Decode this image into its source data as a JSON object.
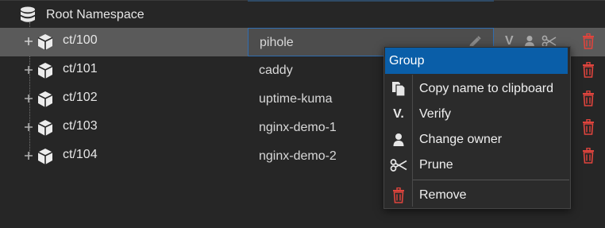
{
  "tree": {
    "root_label": "Root Namespace",
    "rows": [
      {
        "id": "ct/100",
        "name": "pihole",
        "selected": true
      },
      {
        "id": "ct/101",
        "name": "caddy"
      },
      {
        "id": "ct/102",
        "name": "uptime-kuma"
      },
      {
        "id": "ct/103",
        "name": "nginx-demo-1"
      },
      {
        "id": "ct/104",
        "name": "nginx-demo-2"
      }
    ],
    "row_action_icons": [
      "verify-icon",
      "change-owner-icon",
      "prune-icon"
    ],
    "delete_icon": "trash-icon"
  },
  "context_menu": {
    "header": "Group",
    "items": [
      {
        "label": "Copy name to clipboard",
        "icon": "copy-icon"
      },
      {
        "label": "Verify",
        "icon": "verify-icon",
        "glyph": "V."
      },
      {
        "label": "Change owner",
        "icon": "user-icon"
      },
      {
        "label": "Prune",
        "icon": "scissors-icon"
      },
      {
        "label": "Remove",
        "icon": "trash-icon"
      }
    ]
  },
  "colors": {
    "background": "#262626",
    "selected_row": "#5a5a5a",
    "menu_header": "#0a5ea8",
    "danger": "#e0443d"
  }
}
